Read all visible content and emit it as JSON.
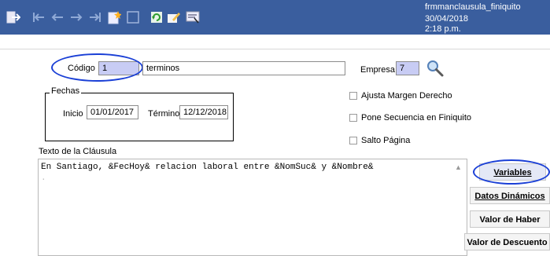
{
  "window": {
    "form_name": "frmmanclausula_finiquito",
    "timestamp": "30/04/2018 2:18 p.m."
  },
  "toolbar": {
    "icons": [
      "exit-icon",
      "first-record-icon",
      "previous-record-icon",
      "next-record-icon",
      "last-record-icon",
      "new-record-icon",
      "blank-icon",
      "refresh-icon",
      "edit-icon",
      "report-icon"
    ]
  },
  "form": {
    "codigo_label": "Código",
    "codigo_value": "1",
    "descripcion_value": "terminos",
    "empresa_label": "Empresa",
    "empresa_value": "7",
    "fechas_legend": "Fechas",
    "inicio_label": "Inicio",
    "inicio_value": "01/01/2017",
    "termino_label": "Término",
    "termino_value": "12/12/2018",
    "checkboxes": [
      {
        "label": "Ajusta Margen Derecho",
        "checked": false
      },
      {
        "label": "Pone Secuencia en Finiquito",
        "checked": false
      },
      {
        "label": "Salto Página",
        "checked": false
      }
    ],
    "texto_label": "Texto de la Cláusula",
    "texto_line1": "En Santiago, &FecHoy& relacion laboral entre &NomSuc& y &Nombre&",
    "texto_line2": "."
  },
  "side_buttons": {
    "variables": "Variables",
    "datos_dinamicos": "Datos Dinámicos",
    "valor_haber": "Valor de Haber",
    "valor_descuento": "Valor de Descuento"
  },
  "colors": {
    "toolbar_bg": "#3a5e9e",
    "highlight_ellipse": "#1a3fd6",
    "code_field_bg": "#c8ccf4"
  }
}
